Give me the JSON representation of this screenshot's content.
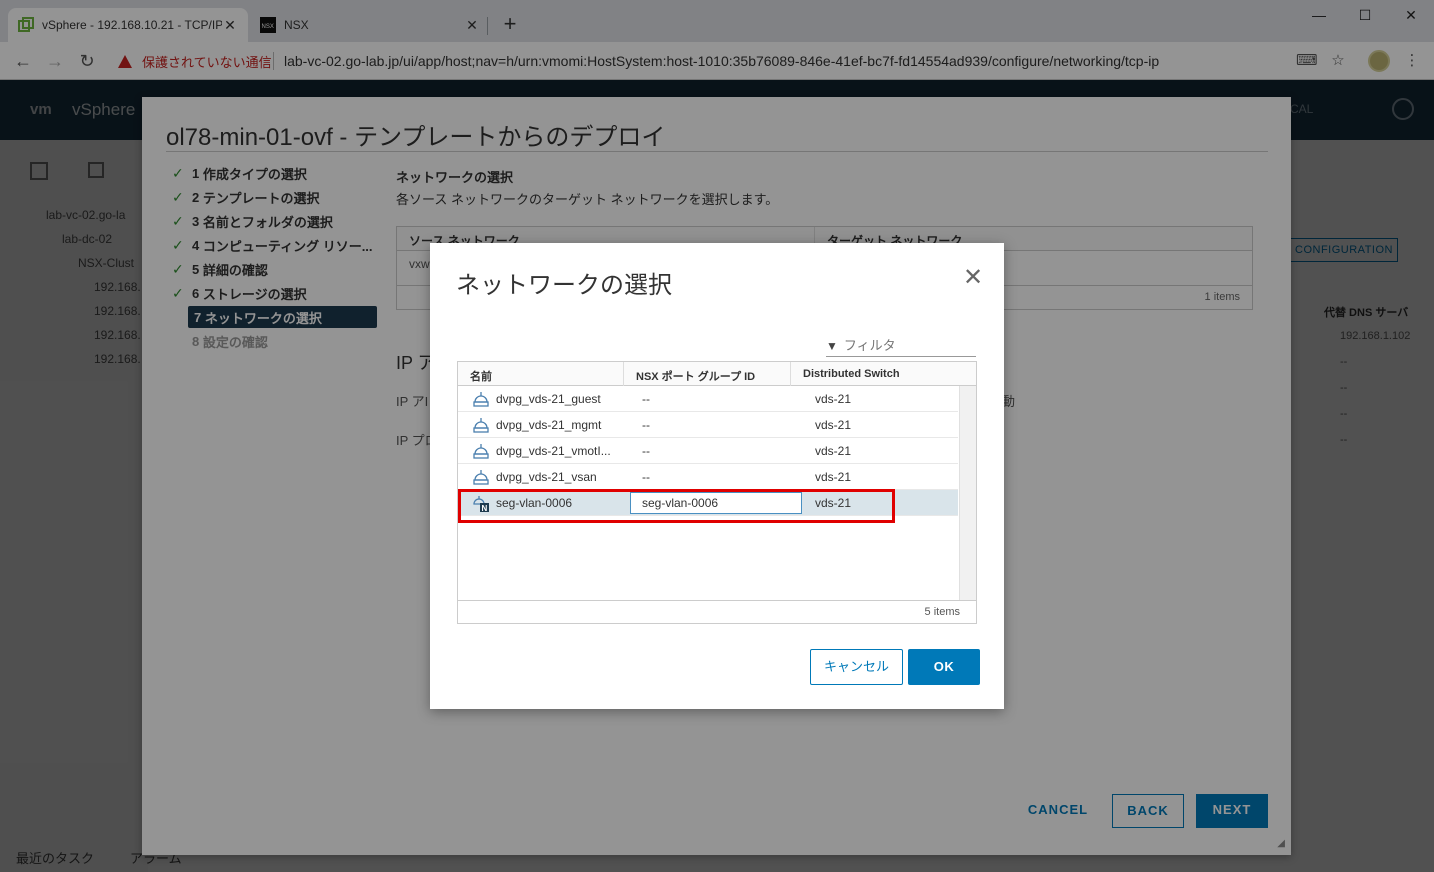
{
  "browser": {
    "tabs": [
      {
        "title": "vSphere - 192.168.10.21 - TCP/IP"
      },
      {
        "title": "NSX"
      }
    ],
    "security_label": "保護されていない通信",
    "url": "lab-vc-02.go-lab.jp/ui/app/host;nav=h/urn:vmomi:HostSystem:host-1010:35b76089-846e-41ef-bc7f-fd14554ad939/configure/networking/tcp-ip"
  },
  "app": {
    "logo": "vm",
    "title": "vSphere",
    "header_right": "CAL",
    "tree": [
      "lab-vc-02.go-la",
      "lab-dc-02",
      "NSX-Clust",
      "192.168.",
      "192.168.",
      "192.168.",
      "192.168."
    ],
    "config_button": "CONFIGURATION",
    "bg_column_header": "代替 DNS サーバ",
    "bg_column_values": [
      "192.168.1.102",
      "--",
      "--",
      "--",
      "--"
    ],
    "bottom_tabs": [
      "最近のタスク",
      "アラーム"
    ]
  },
  "wizard": {
    "title": "ol78-min-01-ovf - テンプレートからのデプロイ",
    "steps": [
      {
        "num": "1",
        "label": "作成タイプの選択",
        "state": "done"
      },
      {
        "num": "2",
        "label": "テンプレートの選択",
        "state": "done"
      },
      {
        "num": "3",
        "label": "名前とフォルダの選択",
        "state": "done"
      },
      {
        "num": "4",
        "label": "コンピューティング リソー...",
        "state": "done"
      },
      {
        "num": "5",
        "label": "詳細の確認",
        "state": "done"
      },
      {
        "num": "6",
        "label": "ストレージの選択",
        "state": "done"
      },
      {
        "num": "7",
        "label": "ネットワークの選択",
        "state": "current"
      },
      {
        "num": "8",
        "label": "設定の確認",
        "state": "disabled"
      }
    ],
    "section_title": "ネットワークの選択",
    "section_desc": "各ソース ネットワークのターゲット ネットワークを選択します。",
    "grid_headers": [
      "ソース ネットワーク",
      "ターゲット ネットワーク"
    ],
    "grid_cell": "vxw",
    "grid_footer": "1 items",
    "ip_title": "IP ア",
    "ip_rows": [
      "IP アI",
      "IP プロ"
    ],
    "ip_right": "動",
    "buttons": {
      "cancel": "CANCEL",
      "back": "BACK",
      "next": "NEXT"
    }
  },
  "modal": {
    "title": "ネットワークの選択",
    "filter_placeholder": "フィルタ",
    "columns": [
      "名前",
      "NSX ポート グループ ID",
      "Distributed Switch"
    ],
    "rows": [
      {
        "name": "dvpg_vds-21_guest",
        "nsx_id": "--",
        "switch": "vds-21",
        "icon": "distributed-portgroup-icon"
      },
      {
        "name": "dvpg_vds-21_mgmt",
        "nsx_id": "--",
        "switch": "vds-21",
        "icon": "distributed-portgroup-icon"
      },
      {
        "name": "dvpg_vds-21_vmotI...",
        "nsx_id": "--",
        "switch": "vds-21",
        "icon": "distributed-portgroup-icon"
      },
      {
        "name": "dvpg_vds-21_vsan",
        "nsx_id": "--",
        "switch": "vds-21",
        "icon": "distributed-portgroup-icon"
      },
      {
        "name": "seg-vlan-0006",
        "nsx_id": "seg-vlan-0006",
        "switch": "vds-21",
        "icon": "nsx-segment-icon"
      }
    ],
    "footer": "5 items",
    "cancel_label": "キャンセル",
    "ok_label": "OK",
    "colors": {
      "accent": "#0079b8",
      "highlight": "#e00000",
      "selected_row": "#d9e4ea"
    }
  }
}
